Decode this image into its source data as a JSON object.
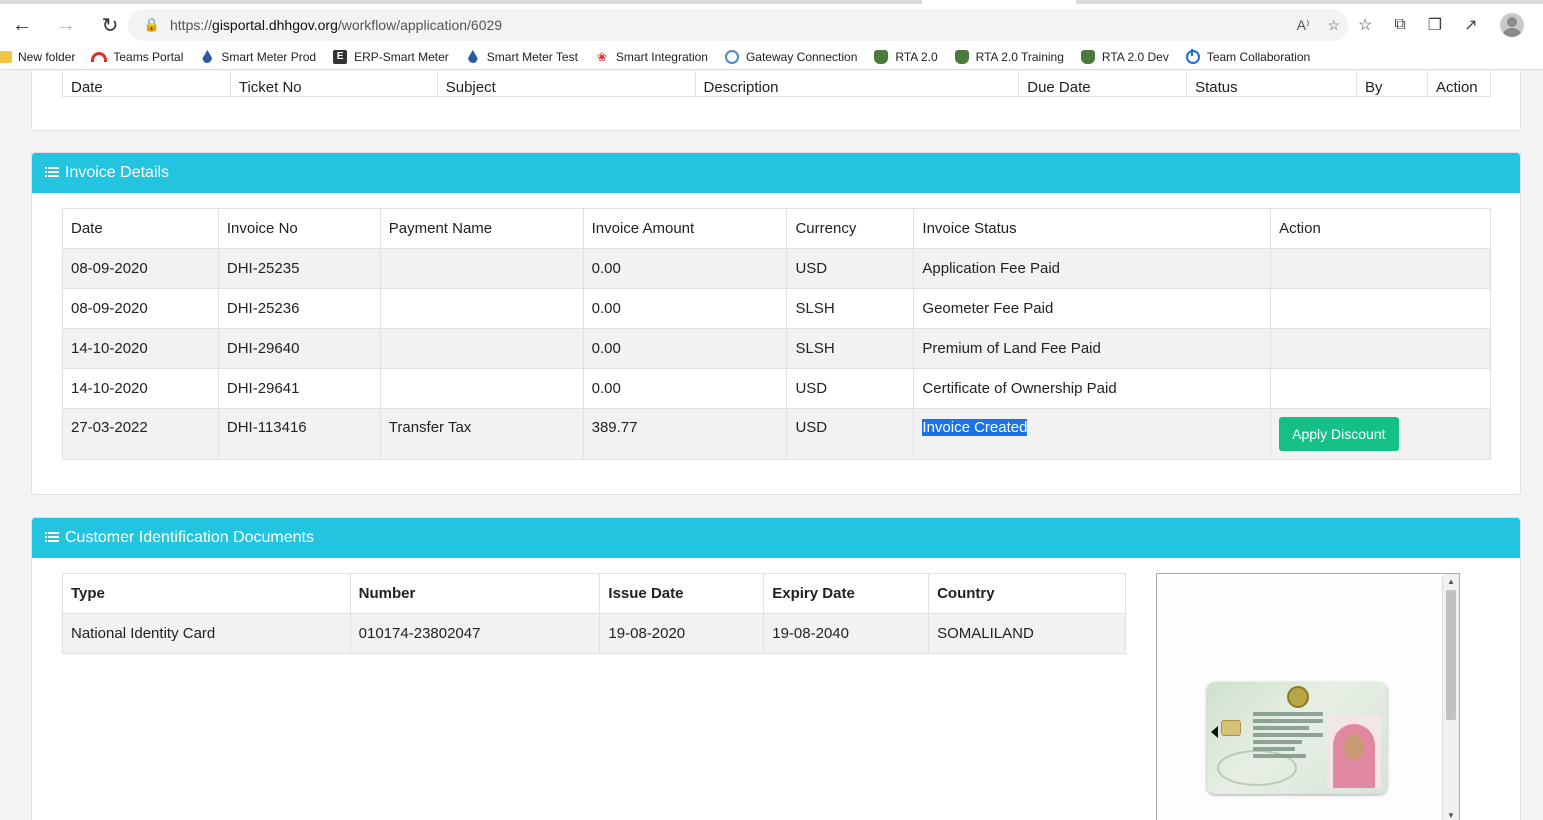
{
  "browser": {
    "url_prefix": "https://",
    "url_domain": "gisportal.dhhgov.org",
    "url_path": "/workflow/application/6029",
    "reader_icon": "read-aloud-icon",
    "favorite_icon": "favorite-add-icon"
  },
  "bookmarks": [
    {
      "label": "New folder",
      "icon": "folder-icon"
    },
    {
      "label": "Teams Portal",
      "icon": "teams-portal-icon"
    },
    {
      "label": "Smart Meter Prod",
      "icon": "drop-icon"
    },
    {
      "label": "ERP-Smart Meter",
      "icon": "e-icon"
    },
    {
      "label": "Smart Meter Test",
      "icon": "drop-icon"
    },
    {
      "label": "Smart Integration",
      "icon": "huawei-icon"
    },
    {
      "label": "Gateway Connection",
      "icon": "gateway-icon"
    },
    {
      "label": "RTA 2.0",
      "icon": "crest-icon"
    },
    {
      "label": "RTA 2.0 Training",
      "icon": "crest-icon"
    },
    {
      "label": "RTA 2.0 Dev",
      "icon": "crest-icon"
    },
    {
      "label": "Team Collaboration",
      "icon": "power-icon"
    }
  ],
  "tickets_table": {
    "headers": [
      "Date",
      "Ticket No",
      "Subject",
      "Description",
      "Due Date",
      "Status",
      "By",
      "Action"
    ]
  },
  "invoice": {
    "title": "Invoice Details",
    "headers": [
      "Date",
      "Invoice No",
      "Payment Name",
      "Invoice Amount",
      "Currency",
      "Invoice Status",
      "Action"
    ],
    "rows": [
      {
        "date": "08-09-2020",
        "no": "DHI-25235",
        "payment": "",
        "amount": "0.00",
        "currency": "USD",
        "status": "Application Fee Paid"
      },
      {
        "date": "08-09-2020",
        "no": "DHI-25236",
        "payment": "",
        "amount": "0.00",
        "currency": "SLSH",
        "status": "Geometer Fee Paid"
      },
      {
        "date": "14-10-2020",
        "no": "DHI-29640",
        "payment": "",
        "amount": "0.00",
        "currency": "SLSH",
        "status": "Premium of Land Fee Paid"
      },
      {
        "date": "14-10-2020",
        "no": "DHI-29641",
        "payment": "",
        "amount": "0.00",
        "currency": "USD",
        "status": "Certificate of Ownership Paid"
      },
      {
        "date": "27-03-2022",
        "no": "DHI-113416",
        "payment": "Transfer Tax",
        "amount": "389.77",
        "currency": "USD",
        "status": "Invoice Created",
        "action": "Apply Discount"
      }
    ]
  },
  "identification": {
    "title": "Customer Identification Documents",
    "headers": [
      "Type",
      "Number",
      "Issue Date",
      "Expiry Date",
      "Country"
    ],
    "rows": [
      {
        "type": "National Identity Card",
        "number": "010174-23802047",
        "issue": "19-08-2020",
        "expiry": "19-08-2040",
        "country": "SOMALILAND"
      }
    ]
  },
  "colors": {
    "header": "#22c4df",
    "apply_button": "#14c088",
    "selection": "#1a73e8"
  }
}
